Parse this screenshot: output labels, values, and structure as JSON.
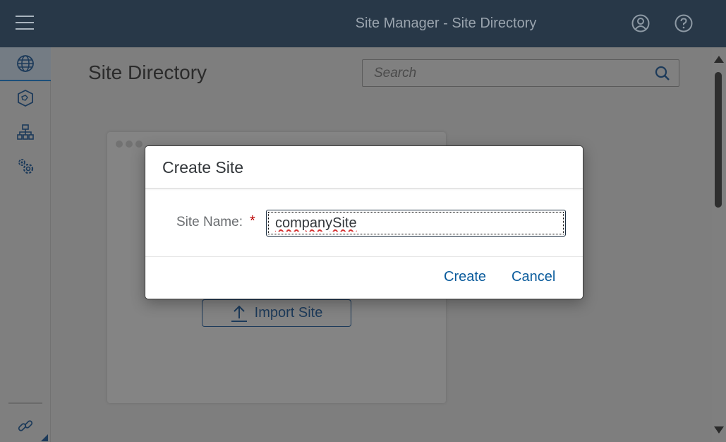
{
  "shell": {
    "title": "Site Manager - Site Directory",
    "icons": [
      "menu-icon",
      "user-icon",
      "help-icon"
    ]
  },
  "sidenav": {
    "items": [
      {
        "name": "sites",
        "icon": "globe-icon",
        "selected": true
      },
      {
        "name": "packages",
        "icon": "cube-icon",
        "selected": false
      },
      {
        "name": "hierarchy",
        "icon": "org-chart-icon",
        "selected": false
      },
      {
        "name": "settings",
        "icon": "gears-icon",
        "selected": false
      }
    ],
    "bottom_icon": "link-icon"
  },
  "main": {
    "page_title": "Site Directory",
    "search": {
      "placeholder": "Search",
      "value": ""
    },
    "import_button": "Import Site"
  },
  "dialog": {
    "title": "Create Site",
    "field_label": "Site Name:",
    "required_marker": "*",
    "field_value": "companySite",
    "create_button": "Create",
    "cancel_button": "Cancel"
  },
  "colors": {
    "shell_bg": "#283848",
    "accent": "#0a5b9c",
    "required": "#bb0000",
    "overlay": "#7f7f7f"
  }
}
